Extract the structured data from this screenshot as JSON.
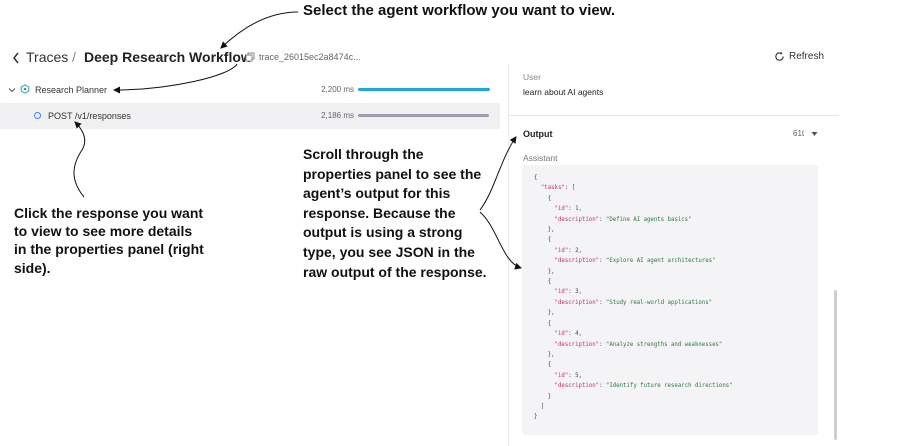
{
  "annotations": {
    "top": "Select the agent workflow you want to view.",
    "left": "Click the response you want to view to see more details in the properties panel (right side).",
    "middle": "Scroll through the properties panel to see the agent’s output for this response. Because the output is using a strong type, you see JSON in the raw output of the response."
  },
  "header": {
    "traces_label": "Traces",
    "separator": "/",
    "title": "Deep Research Workflow",
    "trace_id": "trace_26015ec2a8474c...",
    "refresh_label": "Refresh"
  },
  "tree": {
    "rows": [
      {
        "label": "Research Planner",
        "duration": "2,200 ms",
        "bar_fraction": 1.0
      },
      {
        "label": "POST /v1/responses",
        "duration": "2,186 ms",
        "bar_fraction": 0.99
      }
    ]
  },
  "properties": {
    "user_label": "User",
    "user_message": "learn about AI agents",
    "output_label": "Output",
    "tokens": "61t",
    "assistant_label": "Assistant",
    "tasks": [
      {
        "id": 1,
        "description": "Define AI agents basics"
      },
      {
        "id": 2,
        "description": "Explore AI agent architectures"
      },
      {
        "id": 3,
        "description": "Study real-world applications"
      },
      {
        "id": 4,
        "description": "Analyze strengths and weaknesses"
      },
      {
        "id": 5,
        "description": "Identify future research directions"
      }
    ]
  },
  "colors": {
    "bar_primary": "#21a6dc",
    "bar_secondary": "#a29bb0",
    "json_key": "#c0306a",
    "json_string": "#2c7a3c"
  }
}
